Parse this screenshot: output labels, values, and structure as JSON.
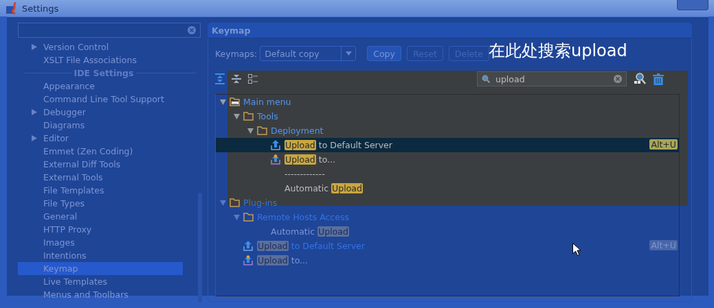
{
  "window": {
    "title": "Settings"
  },
  "sidebar": {
    "items": [
      {
        "label": "Version Control",
        "kind": "item",
        "has_children": true,
        "selected": false
      },
      {
        "label": "XSLT File Associations",
        "kind": "item",
        "has_children": false,
        "selected": false
      },
      {
        "label": "IDE Settings",
        "kind": "section"
      },
      {
        "label": "Appearance",
        "kind": "item",
        "has_children": false,
        "selected": false
      },
      {
        "label": "Command Line Tool Support",
        "kind": "item",
        "has_children": false,
        "selected": false
      },
      {
        "label": "Debugger",
        "kind": "item",
        "has_children": true,
        "selected": false
      },
      {
        "label": "Diagrams",
        "kind": "item",
        "has_children": false,
        "selected": false
      },
      {
        "label": "Editor",
        "kind": "item",
        "has_children": true,
        "selected": false
      },
      {
        "label": "Emmet (Zen Coding)",
        "kind": "item",
        "has_children": false,
        "selected": false
      },
      {
        "label": "External Diff Tools",
        "kind": "item",
        "has_children": false,
        "selected": false
      },
      {
        "label": "External Tools",
        "kind": "item",
        "has_children": false,
        "selected": false
      },
      {
        "label": "File Templates",
        "kind": "item",
        "has_children": false,
        "selected": false
      },
      {
        "label": "File Types",
        "kind": "item",
        "has_children": false,
        "selected": false
      },
      {
        "label": "General",
        "kind": "item",
        "has_children": false,
        "selected": false
      },
      {
        "label": "HTTP Proxy",
        "kind": "item",
        "has_children": false,
        "selected": false
      },
      {
        "label": "Images",
        "kind": "item",
        "has_children": false,
        "selected": false
      },
      {
        "label": "Intentions",
        "kind": "item",
        "has_children": false,
        "selected": false
      },
      {
        "label": "Keymap",
        "kind": "item",
        "has_children": false,
        "selected": true
      },
      {
        "label": "Live Templates",
        "kind": "item",
        "has_children": false,
        "selected": false
      },
      {
        "label": "Menus and Toolbars",
        "kind": "item",
        "has_children": false,
        "selected": false
      }
    ]
  },
  "keymap": {
    "title": "Keymap",
    "keymaps_label": "Keymaps:",
    "keymap_value": "Default copy",
    "buttons": [
      {
        "label": "Copy",
        "disabled": false
      },
      {
        "label": "Reset",
        "disabled": true
      },
      {
        "label": "Delete",
        "disabled": true
      }
    ],
    "search": {
      "value": "upload"
    },
    "annotation": "在此处搜索upload",
    "tree": [
      {
        "kind": "menu",
        "label": "Main menu",
        "expanded": true,
        "spotlit": true,
        "children": [
          {
            "kind": "folder",
            "label": "Tools",
            "expanded": true,
            "spotlit": true,
            "children": [
              {
                "kind": "folder",
                "label": "Deployment",
                "expanded": true,
                "spotlit": true,
                "children": [
                  {
                    "kind": "upload",
                    "match": "Upload",
                    "rest": " to Default Server",
                    "shortcut": "Alt+U",
                    "selected": true,
                    "spotlit": true
                  },
                  {
                    "kind": "upload-as",
                    "match": "Upload",
                    "rest": " to...",
                    "selected": false,
                    "spotlit": true
                  },
                  {
                    "kind": "separator",
                    "label": "-------------",
                    "selected": false,
                    "spotlit": true
                  },
                  {
                    "kind": "text",
                    "before": "Automatic ",
                    "match": "Upload",
                    "selected": false,
                    "spotlit": true
                  }
                ]
              }
            ]
          }
        ]
      },
      {
        "kind": "folder",
        "label": "Plug-ins",
        "expanded": true,
        "spotlit": false,
        "children": [
          {
            "kind": "folder",
            "label": "Remote Hosts Access",
            "expanded": true,
            "spotlit": false,
            "children": [
              {
                "kind": "text",
                "before": "Automatic ",
                "match": "Upload",
                "selected": false,
                "spotlit": false
              }
            ]
          },
          {
            "kind": "upload",
            "match": "Upload",
            "rest": " to Default Server",
            "shortcut": "Alt+U",
            "selected": false,
            "spotlit": false
          },
          {
            "kind": "upload-as",
            "match": "Upload",
            "rest": " to...",
            "selected": false,
            "spotlit": false
          }
        ]
      }
    ]
  }
}
